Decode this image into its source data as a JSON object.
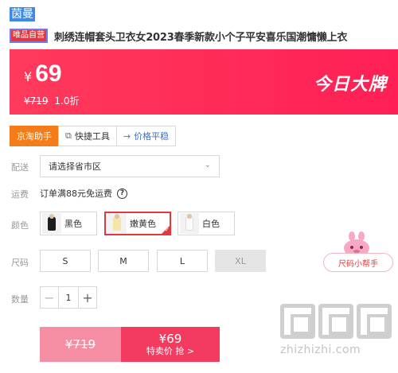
{
  "header": {
    "brand": "茵曼",
    "self_badge": "唯品自营",
    "title": "刺绣连帽套头卫衣女2023春季新款小个子平安喜乐国潮慵懒上衣"
  },
  "price": {
    "currency": "¥",
    "current": "69",
    "original": "¥719",
    "discount": "1.0折",
    "banner_label": "今日大牌"
  },
  "tools": {
    "tabs": [
      {
        "label": "京淘助手",
        "icon": ""
      },
      {
        "label": "快捷工具",
        "icon": "copy-icon"
      },
      {
        "label": "价格平稳",
        "icon": "arrow-right-icon"
      }
    ]
  },
  "delivery": {
    "label": "配送",
    "placeholder": "请选择省市区"
  },
  "shipping": {
    "label": "运费",
    "text": "订单满88元免运费"
  },
  "color": {
    "label": "颜色",
    "options": [
      {
        "name": "黑色",
        "swatch": "#1d1d1d",
        "selected": false
      },
      {
        "name": "嫩黄色",
        "swatch": "#f3e6a6",
        "selected": true
      },
      {
        "name": "白色",
        "swatch": "#f7f7f7",
        "selected": false
      }
    ]
  },
  "size": {
    "label": "尺码",
    "options": [
      {
        "name": "S",
        "disabled": false
      },
      {
        "name": "M",
        "disabled": false
      },
      {
        "name": "L",
        "disabled": false
      },
      {
        "name": "XL",
        "disabled": true
      }
    ],
    "helper": "尺码小帮手"
  },
  "quantity": {
    "label": "数量",
    "value": "1"
  },
  "buy": {
    "original": "¥719",
    "price": "¥69",
    "cta": "特卖价 抢 >"
  },
  "watermark": {
    "site": "zhizhizhi.com"
  },
  "colors": {
    "accent": "#ff2a58",
    "tool_active": "#f57c18",
    "buy_left": "#f68ea3",
    "buy_right": "#f23b5f"
  }
}
